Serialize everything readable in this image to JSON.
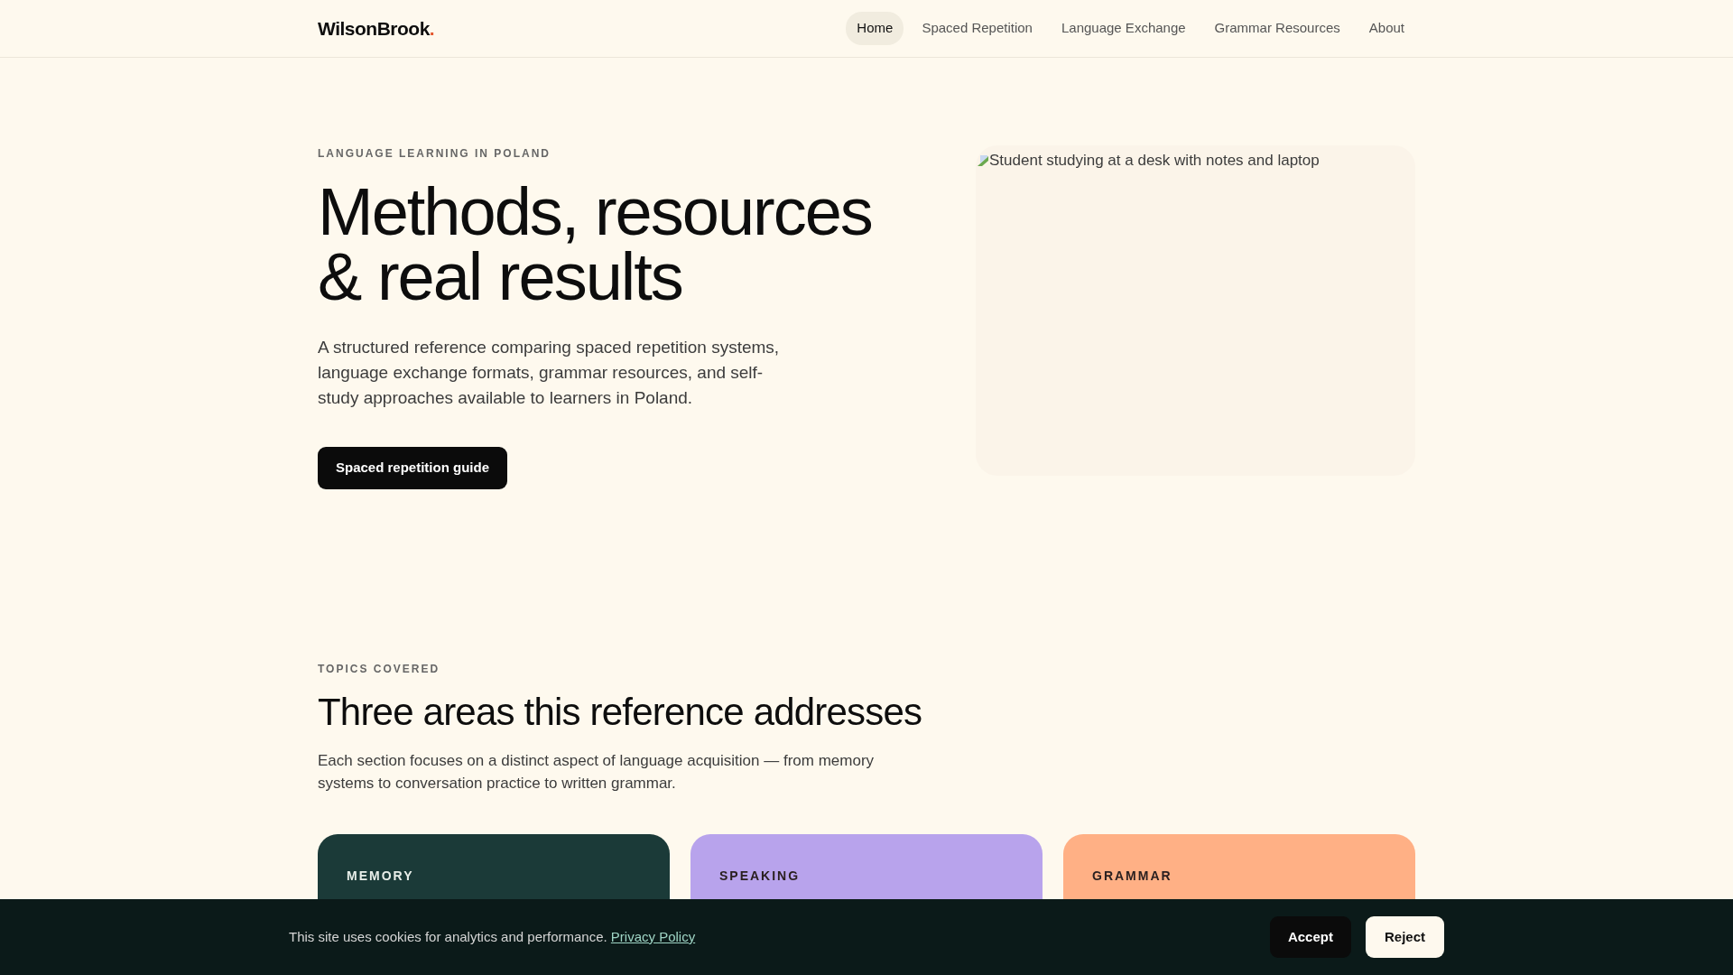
{
  "brand": {
    "name": "WilsonBrook",
    "dot": "."
  },
  "nav": [
    {
      "label": "Home",
      "selected": true
    },
    {
      "label": "Spaced Repetition",
      "selected": false
    },
    {
      "label": "Language Exchange",
      "selected": false
    },
    {
      "label": "Grammar Resources",
      "selected": false
    },
    {
      "label": "About",
      "selected": false
    }
  ],
  "hero": {
    "eyebrow": "LANGUAGE LEARNING IN POLAND",
    "title_lines": [
      "Methods, resources",
      "& real results"
    ],
    "text": "A structured reference comparing spaced repetition systems, language exchange formats, grammar resources, and self-study approaches available to learners in Poland.",
    "button": "Spaced repetition guide",
    "image_alt": "Student studying at a desk with notes and laptop"
  },
  "topics": {
    "eyebrow": "TOPICS COVERED",
    "title": "Three areas this reference addresses",
    "text": "Each section focuses on a distinct aspect of language acquisition — from memory systems to conversation practice to written grammar.",
    "cards": [
      {
        "tag": "MEMORY",
        "color": "#1b3a38"
      },
      {
        "tag": "SPEAKING",
        "color": "#b8a3ec"
      },
      {
        "tag": "GRAMMAR",
        "color": "#ffb085"
      }
    ]
  },
  "cookie": {
    "text": "This site uses cookies for analytics and performance.",
    "link": "Privacy Policy",
    "accept": "Accept",
    "reject": "Reject"
  }
}
